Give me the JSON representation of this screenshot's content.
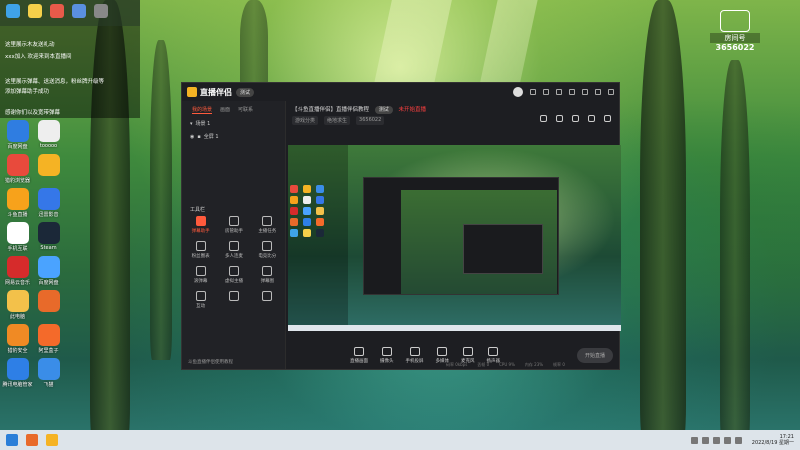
{
  "top_left": {
    "messages": [
      "这里展示木友送礼动",
      "xxx加入 欢迎来到本直播间",
      "这里展示弹幕、送送消息，粉丝牌升级等",
      "添加弹幕助手成功",
      "感谢你们以及宽带弹幕"
    ]
  },
  "desktop": {
    "icons": [
      {
        "label": "百度网盘",
        "color": "#2f7de1"
      },
      {
        "label": "tooooo",
        "color": "#eeeeee"
      },
      {
        "label": "猎豹浏览器",
        "color": "#e84a3c"
      },
      {
        "label": "",
        "color": "#f5b324"
      },
      {
        "label": "斗鱼直播",
        "color": "#f7a21b"
      },
      {
        "label": "迅雷影音",
        "color": "#3577e8"
      },
      {
        "label": "手机互联",
        "color": "#ffffff"
      },
      {
        "label": "Steam",
        "color": "#1b2838"
      },
      {
        "label": "网易云音乐",
        "color": "#d62b2b"
      },
      {
        "label": "百度网盘",
        "color": "#4aa3ff"
      },
      {
        "label": "此电脑",
        "color": "#f3c14a"
      },
      {
        "label": "",
        "color": "#e86a2a"
      },
      {
        "label": "猎豹安全",
        "color": "#f08a24"
      },
      {
        "label": "阿里盒子",
        "color": "#f46a2a"
      },
      {
        "label": "腾讯电脑管家",
        "color": "#2e7fe6"
      },
      {
        "label": "飞猫",
        "color": "#3a8de8"
      }
    ]
  },
  "window": {
    "title": "直播伴侣",
    "badge": "测试",
    "tabs": [
      "我的场景",
      "画面",
      "可联系"
    ],
    "active_tab": "我的场景",
    "scene_label": "场景 1",
    "layer_label": "全屏 1",
    "tools_heading": "工具栏",
    "tools": [
      {
        "label": "弹幕助手",
        "active": true
      },
      {
        "label": "房管助手",
        "active": false
      },
      {
        "label": "主播任务",
        "active": false
      },
      {
        "label": "粉丝圈表",
        "active": false
      },
      {
        "label": "多人连麦",
        "active": false
      },
      {
        "label": "电竞比分",
        "active": false
      },
      {
        "label": "滚弹幕",
        "active": false
      },
      {
        "label": "虚拟主播",
        "active": false
      },
      {
        "label": "弹幕图",
        "active": false
      },
      {
        "label": "互动",
        "active": false
      },
      {
        "label": "",
        "active": false
      },
      {
        "label": "",
        "active": false
      }
    ],
    "left_footer": "斗鱼直播伴侣使用教程",
    "room_title": "【斗鱼直播伴侣】直播伴侣教程",
    "room_tag": "测试",
    "live_status": "未开始直播",
    "room_meta": [
      "游戏分类",
      "绝地求生",
      "3656022"
    ],
    "controls": [
      "直播画面",
      "摄像头",
      "手机投屏",
      "多媒体",
      "麦克风",
      "扬声器"
    ],
    "start_button": "开始直播",
    "status_items": [
      "码率 0kbps",
      "丢帧 0",
      "CPU 9%",
      "内存 23%",
      "帧率 0"
    ]
  },
  "watermark": {
    "line1": "房间号",
    "line2": "3656022"
  },
  "taskbar": {
    "time": "17:21",
    "date": "2022/8/19 星期一"
  }
}
